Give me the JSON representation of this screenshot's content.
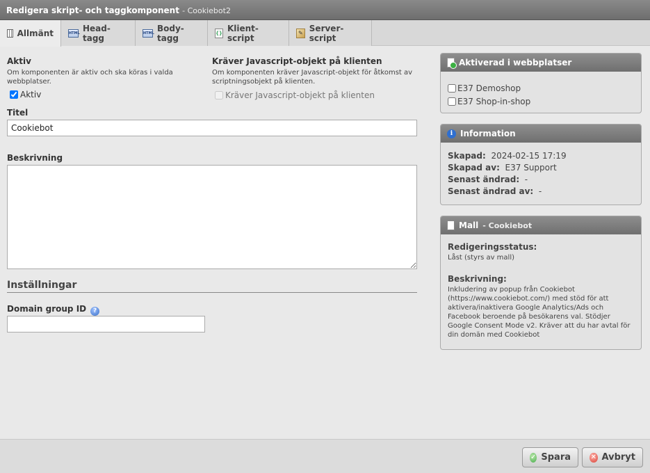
{
  "window": {
    "title": "Redigera skript- och taggkomponent",
    "subtitle": "- Cookiebot2"
  },
  "tabs": [
    {
      "label": "Allmänt",
      "icon": "calendar-grid-icon",
      "active": true
    },
    {
      "label": "Head-tagg",
      "icon": "html-icon"
    },
    {
      "label": "Body-tagg",
      "icon": "html-icon"
    },
    {
      "label": "Klient-script",
      "icon": "javascript-file-icon"
    },
    {
      "label": "Server-script",
      "icon": "server-script-icon"
    }
  ],
  "tab_icon_text": {
    "html": "HTML",
    "js": "{}",
    "srv": "✎"
  },
  "aktiv": {
    "heading": "Aktiv",
    "description": "Om komponenten är aktiv och ska köras i valda webbplatser.",
    "checkbox_label": "Aktiv",
    "checked": true
  },
  "requires_js": {
    "heading": "Kräver Javascript-objekt på klienten",
    "description": "Om komponenten kräver Javascript-objekt för åtkomst av scriptningsobjekt på klienten.",
    "checkbox_label": "Kräver Javascript-objekt på klienten",
    "checked": false,
    "disabled": true
  },
  "titel": {
    "label": "Titel",
    "value": "Cookiebot"
  },
  "beskrivning": {
    "label": "Beskrivning",
    "value": ""
  },
  "installningar": {
    "heading": "Inställningar"
  },
  "domain_group": {
    "label": "Domain group ID",
    "help_glyph": "?",
    "value": ""
  },
  "sites_panel": {
    "title": "Aktiverad i webbplatser",
    "sites": [
      {
        "label": "E37 Demoshop",
        "checked": false
      },
      {
        "label": "E37 Shop-in-shop",
        "checked": false
      }
    ]
  },
  "info_panel": {
    "title": "Information",
    "icon_glyph": "i",
    "rows": [
      {
        "key": "Skapad:",
        "value": "2024-02-15 17:19"
      },
      {
        "key": "Skapad av:",
        "value": "E37 Support"
      },
      {
        "key": "Senast ändrad:",
        "value": "-"
      },
      {
        "key": "Senast ändrad av:",
        "value": "-"
      }
    ]
  },
  "mall_panel": {
    "title": "Mall",
    "subtitle": "- Cookiebot",
    "status_label": "Redigeringsstatus:",
    "status_value": "Låst (styrs av mall)",
    "desc_label": "Beskrivning:",
    "desc_value": "Inkludering av popup från Cookiebot (https://www.cookiebot.com/) med stöd för att aktivera/inaktivera Google Analytics/Ads och Facebook beroende på besökarens val. Stödjer Google Consent Mode v2. Kräver att du har avtal för din domän med Cookiebot"
  },
  "footer": {
    "save_label": "Spara",
    "save_glyph": "✓",
    "cancel_label": "Avbryt",
    "cancel_glyph": "✕"
  }
}
